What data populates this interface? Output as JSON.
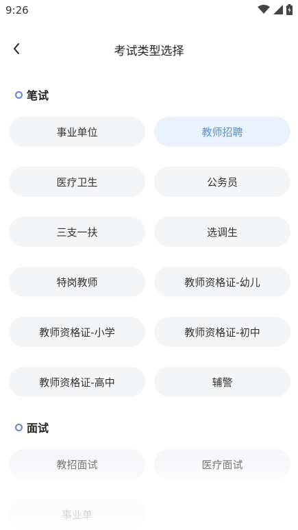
{
  "status_bar": {
    "time": "9:26"
  },
  "header": {
    "title": "考试类型选择"
  },
  "sections": {
    "written": {
      "title": "笔试",
      "items": [
        "事业单位",
        "教师招聘",
        "医疗卫生",
        "公务员",
        "三支一扶",
        "选调生",
        "特岗教师",
        "教师资格证-幼儿",
        "教师资格证-小学",
        "教师资格证-初中",
        "教师资格证-高中",
        "辅警"
      ],
      "selected": "教师招聘"
    },
    "interview": {
      "title": "面试",
      "items": [
        "教招面试",
        "医疗面试",
        "事业单"
      ]
    }
  },
  "colors": {
    "accent": "#5a8fdc",
    "selected_bg": "#eaf2fd",
    "pill_bg": "#f4f5f7",
    "section_dot": "#5a87d8"
  }
}
